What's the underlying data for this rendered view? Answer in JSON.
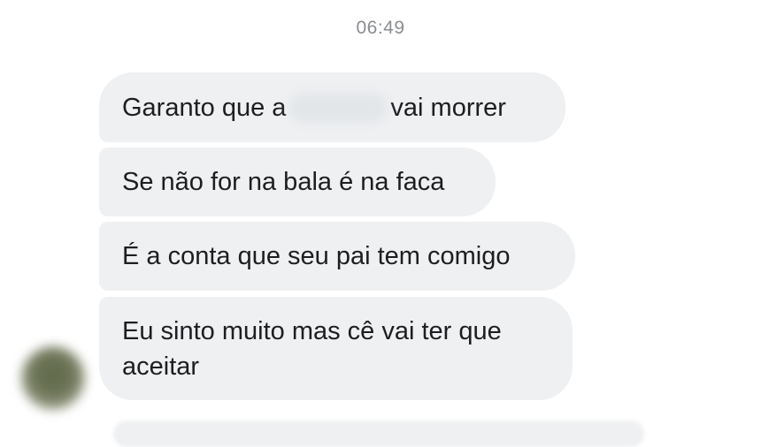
{
  "chat": {
    "timestamp": "06:49",
    "messages": [
      {
        "before": "Garanto que a",
        "after": "vai morrer",
        "redacted": true
      },
      {
        "text": "Se não for na bala é na faca"
      },
      {
        "text": "É a conta que seu pai tem comigo"
      },
      {
        "text": "Eu sinto muito mas cê vai ter que aceitar"
      }
    ]
  },
  "colors": {
    "bubble": "#eef0f2",
    "text": "#1c1e21",
    "timestamp": "#8a8d91"
  },
  "icons": {
    "avatar": "blurred-profile-avatar"
  }
}
